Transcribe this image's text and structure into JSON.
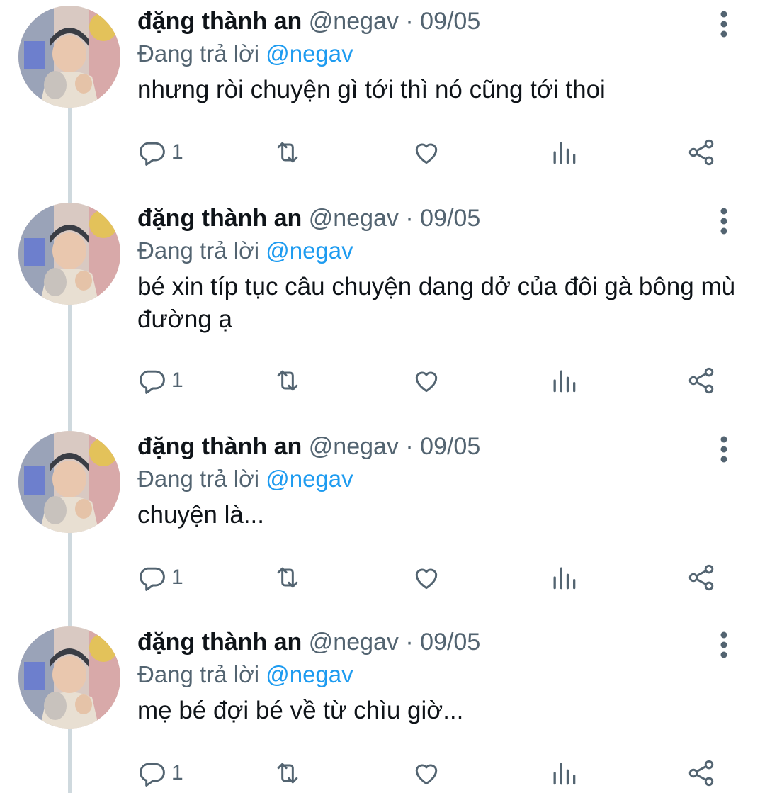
{
  "tweets": [
    {
      "author_name": "đặng thành an",
      "handle": "@negav",
      "separator": "·",
      "date": "09/05",
      "reply_prefix": "Đang trả lời",
      "reply_to": "@negav",
      "text": "nhưng ròi chuyện gì tới thì nó cũng tới thoi",
      "reply_count": "1"
    },
    {
      "author_name": "đặng thành an",
      "handle": "@negav",
      "separator": "·",
      "date": "09/05",
      "reply_prefix": "Đang trả lời",
      "reply_to": "@negav",
      "text": "bé xin típ tục câu chuyện dang dở của đôi gà bông mù đường ạ",
      "reply_count": "1"
    },
    {
      "author_name": "đặng thành an",
      "handle": "@negav",
      "separator": "·",
      "date": "09/05",
      "reply_prefix": "Đang trả lời",
      "reply_to": "@negav",
      "text": "chuyện là...",
      "reply_count": "1"
    },
    {
      "author_name": "đặng thành an",
      "handle": "@negav",
      "separator": "·",
      "date": "09/05",
      "reply_prefix": "Đang trả lời",
      "reply_to": "@negav",
      "text": "mẹ bé đợi bé về từ chìu giờ...",
      "reply_count": "1"
    }
  ],
  "icons": {
    "reply": "reply-icon",
    "retweet": "retweet-icon",
    "like": "heart-icon",
    "views": "views-icon",
    "share": "share-icon",
    "more": "more-vertical-icon"
  },
  "colors": {
    "text": "#0f1419",
    "secondary": "#536471",
    "link": "#1d9bf0",
    "thread_line": "#cfd9de"
  }
}
